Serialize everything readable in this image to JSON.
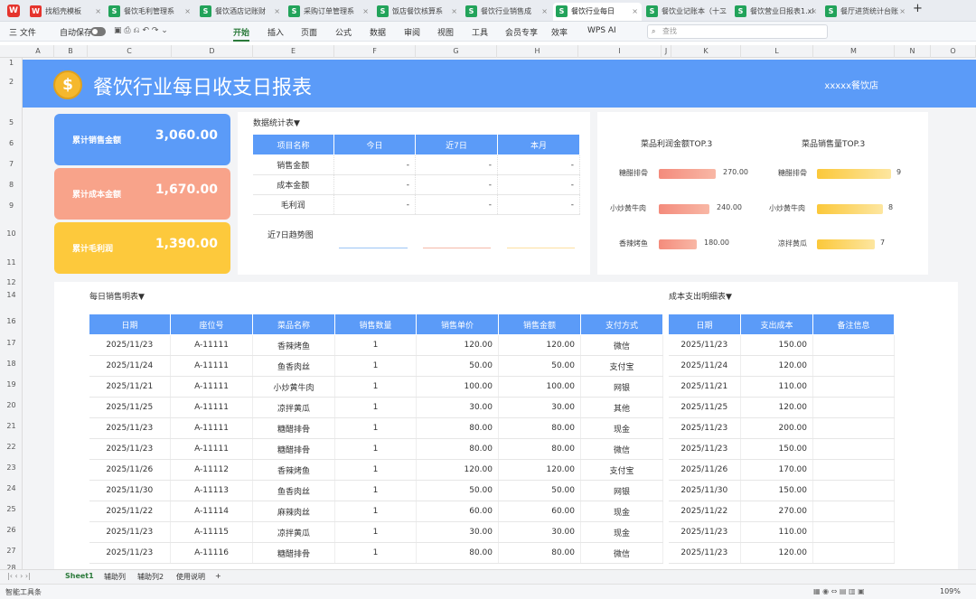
{
  "tabs": [
    {
      "label": "找稻壳模板",
      "x": "×"
    },
    {
      "label": "餐饮毛利管理系",
      "x": "×"
    },
    {
      "label": "餐饮酒店记账财",
      "x": "×"
    },
    {
      "label": "采购订单管理系",
      "x": "×"
    },
    {
      "label": "饭店餐饮核算系",
      "x": "×"
    },
    {
      "label": "餐饮行业销售成",
      "x": "×"
    },
    {
      "label": "餐饮行业每日",
      "x": "×"
    },
    {
      "label": "餐饮业记账本（十二",
      "x": "×"
    },
    {
      "label": "餐饮营业日报表1.xl",
      "x": "×"
    },
    {
      "label": "餐厅进货统计台账",
      "x": "×"
    }
  ],
  "tab_add": "+",
  "menu": {
    "file": "三 文件",
    "autosave": "自动保存",
    "items": [
      "开始",
      "插入",
      "页面",
      "公式",
      "数据",
      "审阅",
      "视图",
      "工具",
      "会员专享",
      "效率",
      "WPS AI"
    ],
    "search_placeholder": "查找"
  },
  "columns": [
    "A",
    "B",
    "C",
    "D",
    "E",
    "F",
    "G",
    "H",
    "I",
    "J",
    "K",
    "L",
    "M",
    "N",
    "O"
  ],
  "rows": [
    "1",
    "2",
    "5",
    "6",
    "7",
    "8",
    "9",
    "10",
    "11",
    "12",
    "14",
    "16",
    "17",
    "18",
    "19",
    "20",
    "21",
    "22",
    "23",
    "24",
    "25",
    "26",
    "27",
    "28"
  ],
  "banner": {
    "coin": "$",
    "title": "餐饮行业每日收支日报表",
    "store": "xxxxx餐饮店"
  },
  "cards": [
    {
      "label": "累计销售金额",
      "value": "3,060.00",
      "color": "#5b9bf8"
    },
    {
      "label": "累计成本金额",
      "value": "1,670.00",
      "color": "#f8a38a"
    },
    {
      "label": "累计毛利润",
      "value": "1,390.00",
      "color": "#fdc93c"
    }
  ],
  "stats": {
    "title": "数据统计表▼",
    "headers": [
      "项目名称",
      "今日",
      "近7日",
      "本月"
    ],
    "rows": [
      [
        "销售金额",
        "-",
        "-",
        "-"
      ],
      [
        "成本金额",
        "-",
        "-",
        "-"
      ],
      [
        "毛利润",
        "-",
        "-",
        "-"
      ]
    ],
    "trend_label": "近7日趋势图"
  },
  "top_profit": {
    "title": "菜品利润金额TOP.3",
    "items": [
      {
        "name": "糖醋排骨",
        "value": "270.00",
        "v": 270
      },
      {
        "name": "小炒黄牛肉",
        "value": "240.00",
        "v": 240
      },
      {
        "name": "香辣烤鱼",
        "value": "180.00",
        "v": 180
      }
    ]
  },
  "top_qty": {
    "title": "菜品销售量TOP.3",
    "items": [
      {
        "name": "糖醋排骨",
        "value": "9",
        "v": 9
      },
      {
        "name": "小炒黄牛肉",
        "value": "8",
        "v": 8
      },
      {
        "name": "凉拌黄瓜",
        "value": "7",
        "v": 7
      }
    ]
  },
  "sales": {
    "title": "每日销售明表▼",
    "headers": [
      "日期",
      "座位号",
      "菜品名称",
      "销售数量",
      "销售单价",
      "销售金额",
      "支付方式"
    ],
    "rows": [
      [
        "2025/11/23",
        "A-11111",
        "香辣烤鱼",
        "1",
        "120.00",
        "120.00",
        "微信"
      ],
      [
        "2025/11/24",
        "A-11111",
        "鱼香肉丝",
        "1",
        "50.00",
        "50.00",
        "支付宝"
      ],
      [
        "2025/11/21",
        "A-11111",
        "小炒黄牛肉",
        "1",
        "100.00",
        "100.00",
        "网银"
      ],
      [
        "2025/11/25",
        "A-11111",
        "凉拌黄瓜",
        "1",
        "30.00",
        "30.00",
        "其他"
      ],
      [
        "2025/11/23",
        "A-11111",
        "糖醋排骨",
        "1",
        "80.00",
        "80.00",
        "现金"
      ],
      [
        "2025/11/23",
        "A-11111",
        "糖醋排骨",
        "1",
        "80.00",
        "80.00",
        "微信"
      ],
      [
        "2025/11/26",
        "A-11112",
        "香辣烤鱼",
        "1",
        "120.00",
        "120.00",
        "支付宝"
      ],
      [
        "2025/11/30",
        "A-11113",
        "鱼香肉丝",
        "1",
        "50.00",
        "50.00",
        "网银"
      ],
      [
        "2025/11/22",
        "A-11114",
        "麻辣肉丝",
        "1",
        "60.00",
        "60.00",
        "现金"
      ],
      [
        "2025/11/23",
        "A-11115",
        "凉拌黄瓜",
        "1",
        "30.00",
        "30.00",
        "现金"
      ],
      [
        "2025/11/23",
        "A-11116",
        "糖醋排骨",
        "1",
        "80.00",
        "80.00",
        "微信"
      ]
    ]
  },
  "cost": {
    "title": "成本支出明细表▼",
    "headers": [
      "日期",
      "支出成本",
      "备注信息"
    ],
    "rows": [
      [
        "2025/11/23",
        "150.00",
        ""
      ],
      [
        "2025/11/24",
        "120.00",
        ""
      ],
      [
        "2025/11/21",
        "110.00",
        ""
      ],
      [
        "2025/11/25",
        "120.00",
        ""
      ],
      [
        "2025/11/23",
        "200.00",
        ""
      ],
      [
        "2025/11/23",
        "150.00",
        ""
      ],
      [
        "2025/11/26",
        "170.00",
        ""
      ],
      [
        "2025/11/30",
        "150.00",
        ""
      ],
      [
        "2025/11/22",
        "270.00",
        ""
      ],
      [
        "2025/11/23",
        "110.00",
        ""
      ],
      [
        "2025/11/23",
        "120.00",
        ""
      ]
    ]
  },
  "sheets": [
    "Sheet1",
    "辅助列",
    "辅助列2",
    "使用说明",
    "+"
  ],
  "status": {
    "left": "智能工具条",
    "zoom": "109%"
  }
}
